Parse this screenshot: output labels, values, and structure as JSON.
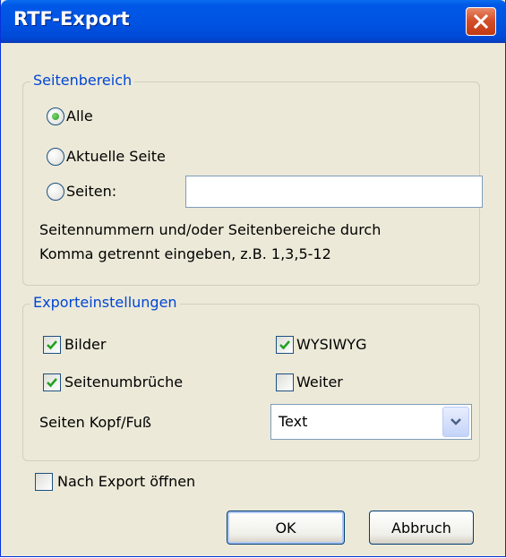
{
  "window": {
    "title": "RTF-Export"
  },
  "page_range": {
    "legend": "Seitenbereich",
    "options": {
      "all": "Alle",
      "current": "Aktuelle Seite",
      "pages": "Seiten:"
    },
    "pages_input_value": "",
    "hint_line1": "Seitennummern und/oder Seitenbereiche durch",
    "hint_line2": "Komma getrennt eingeben, z.B. 1,3,5-12",
    "selected": "all"
  },
  "export_settings": {
    "legend": "Exporteinstellungen",
    "bilder": {
      "label": "Bilder",
      "checked": true
    },
    "wysiwyg": {
      "label": "WYSIWYG",
      "checked": true
    },
    "seitenumbrueche": {
      "label": "Seitenumbrüche",
      "checked": true
    },
    "weiter": {
      "label": "Weiter",
      "checked": false
    },
    "header_footer_label": "Seiten Kopf/Fuß",
    "header_footer_value": "Text"
  },
  "open_after_export": {
    "label": "Nach Export öffnen",
    "checked": false
  },
  "buttons": {
    "ok": "OK",
    "cancel": "Abbruch"
  },
  "colors": {
    "title_bar": "#0054e3",
    "legend_text": "#0046d5",
    "dialog_bg": "#ece9d8",
    "close_button": "#d4502a"
  }
}
